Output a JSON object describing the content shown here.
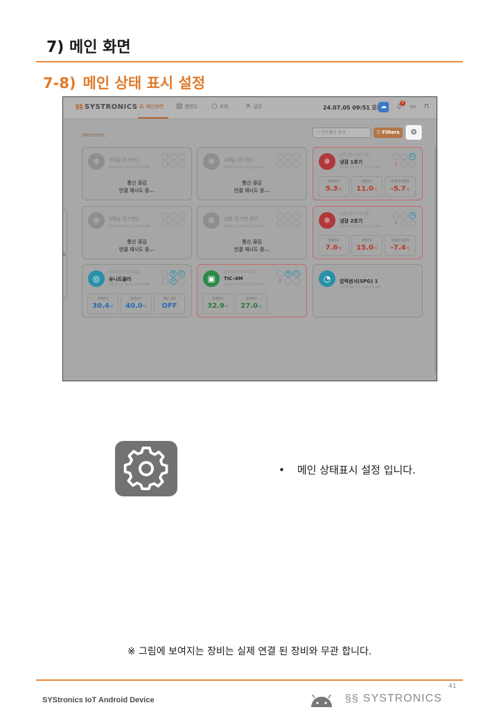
{
  "heading": "7) 메인 화면",
  "subheading": {
    "number": "7-8)",
    "title": "메인 상태 표시 설정"
  },
  "app": {
    "logo": "SYSTRONICS",
    "nav": [
      {
        "label": "메인화면",
        "icon": "home-icon"
      },
      {
        "label": "평면도",
        "icon": "floorplan-icon"
      },
      {
        "label": "조회",
        "icon": "search-icon"
      },
      {
        "label": "설정",
        "icon": "tools-icon"
      }
    ],
    "datetime": "24.07.05 09:51 오전",
    "bell_badge": "7",
    "welcome": "Welcome,",
    "search_placeholder": "컨트롤러 검색...",
    "filters_label": "Filters",
    "cards": [
      {
        "group": "",
        "name": "3채널 환기팬1",
        "date": "2024-07-04 3:31:54 AM",
        "status1": "통신 끊김",
        "status2": "연결 재시도 중..."
      },
      {
        "group": "",
        "name": "3채널 환기팬2",
        "date": "2024-07-04 3:31:54 AM",
        "status1": "통신 끊김",
        "status2": "연결 재시도 중..."
      },
      {
        "group": "상위그룹1 하위그룹1",
        "name": "냉장 1호기",
        "date": "2024-07-05 3:31:47 AM",
        "values": [
          {
            "label": "현재온도",
            "value": "5.3",
            "unit": "°C",
            "color": "red"
          },
          {
            "label": "설정온도",
            "value": "11.0",
            "unit": "°C",
            "color": "red"
          },
          {
            "label": "현재 온도편차",
            "value": "-5.7",
            "unit": "°C",
            "color": "red"
          }
        ]
      },
      {
        "group": "",
        "name": "3채널 환기팬3",
        "date": "2024-07-04 3:31:54 AM",
        "status1": "통신 끊김",
        "status2": "연결 재시도 중..."
      },
      {
        "group": "",
        "name": "대형 환기팬 제어",
        "date": "2024-07-04 3:31:54 AM",
        "status1": "통신 끊김",
        "status2": "연결 재시도 중..."
      },
      {
        "group": "상위그룹1 하위그룹1",
        "name": "냉장 2호기",
        "date": "2024-07-05 3:31:47 AM",
        "values": [
          {
            "label": "현재온도",
            "value": "7.6",
            "unit": "°C",
            "color": "red"
          },
          {
            "label": "설정온도",
            "value": "15.0",
            "unit": "°C",
            "color": "red"
          },
          {
            "label": "현재 온도편차",
            "value": "-7.4",
            "unit": "°C",
            "color": "red"
          }
        ]
      },
      {
        "group": "상위그룹1 하위그룹1",
        "name": "유니트쿨러",
        "date": "2024-07-05 3:31:45 AM",
        "values": [
          {
            "label": "현재온도",
            "value": "30.4",
            "unit": "°C",
            "color": "blue"
          },
          {
            "label": "설정온도",
            "value": "40.0",
            "unit": "°C",
            "color": "blue"
          },
          {
            "label": "제상 상태",
            "value": "OFF",
            "unit": "",
            "color": "blue"
          }
        ]
      },
      {
        "group": "상위그룹1 하위그룹1",
        "name": "TIC-4M",
        "date": "2024-07-05 3:31:44 AM",
        "values": [
          {
            "label": "현재온도",
            "value": "32.9",
            "unit": "°C",
            "color": "green"
          },
          {
            "label": "설정온도",
            "value": "27.0",
            "unit": "°C",
            "color": "green"
          }
        ]
      },
      {
        "group": "",
        "name": "압력센서(SPG) 1",
        "date": "2024-06-25 3:31:40 AM"
      }
    ]
  },
  "bullet_text": "메인 상태표시 설정 입니다.",
  "note": "※ 그림에 보여지는 장비는 실제 연결 된 장비와 무관 합니다.",
  "page_number": "41",
  "footer": "SYStronics IoT Android Device",
  "footer_logo": "SYSTRONICS",
  "colors": {
    "accent": "#e8883a",
    "heading_orange": "#e07a2a",
    "gear_tile": "#727272"
  }
}
